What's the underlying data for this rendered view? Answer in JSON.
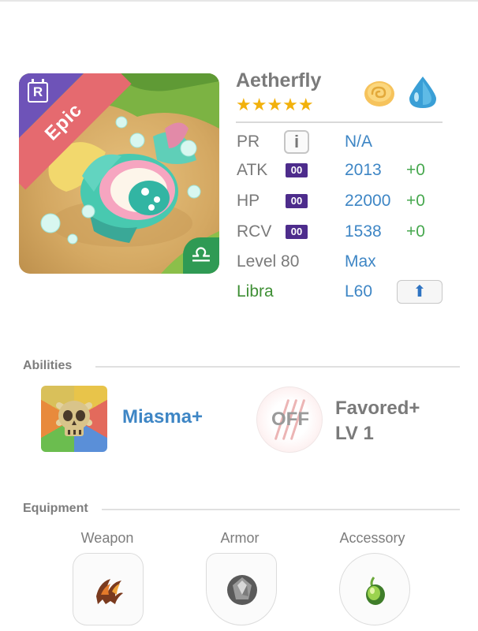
{
  "monster": {
    "name": "Aetherfly",
    "stars": "★★★★★",
    "rarity_label": "Epic",
    "rarity_letter": "R",
    "sign_symbol": "♎",
    "elements": [
      "cloud-element-icon",
      "water-element-icon"
    ]
  },
  "stats": {
    "pr": {
      "label": "PR",
      "info": "i",
      "value": "N/A"
    },
    "atk": {
      "label": "ATK",
      "badge": "00",
      "value": "2013",
      "bonus": "+0"
    },
    "hp": {
      "label": "HP",
      "badge": "00",
      "value": "22000",
      "bonus": "+0"
    },
    "rcv": {
      "label": "RCV",
      "badge": "00",
      "value": "1538",
      "bonus": "+0"
    },
    "level": {
      "label": "Level 80",
      "value": "Max"
    },
    "sign": {
      "label": "Libra",
      "value": "L60",
      "button_icon": "⬆"
    }
  },
  "abilities": {
    "title": "Abilities",
    "primary": {
      "name": "Miasma+",
      "icon": "skull-icon"
    },
    "off_badge": "OFF",
    "secondary_line1": "Favored+",
    "secondary_line2": "LV 1"
  },
  "equipment": {
    "title": "Equipment",
    "slots": [
      {
        "label": "Weapon",
        "icon": "claw-weapon-icon"
      },
      {
        "label": "Armor",
        "icon": "gem-armor-icon"
      },
      {
        "label": "Accessory",
        "icon": "leaf-accessory-icon"
      }
    ]
  },
  "colors": {
    "accent_blue": "#3e86c5",
    "bonus_green": "#47a84f",
    "epic_ribbon": "#e56a6f",
    "star_gold": "#f2b10c"
  }
}
